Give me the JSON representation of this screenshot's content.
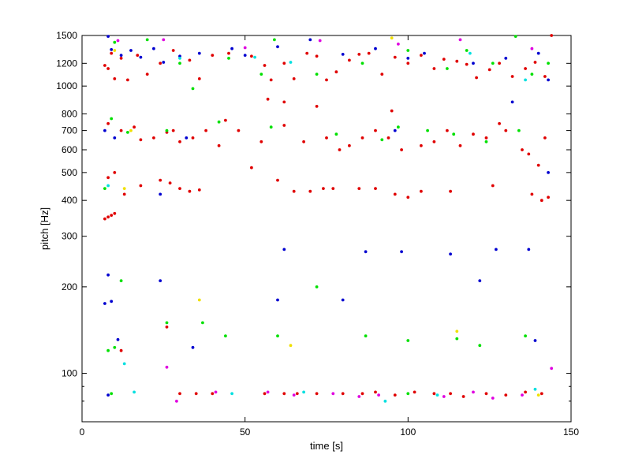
{
  "chart_data": {
    "type": "scatter",
    "title": "",
    "xlabel": "time [s]",
    "ylabel": "pitch [Hz]",
    "xlim": [
      0,
      150
    ],
    "ylim": [
      70,
      1500
    ],
    "y_scale": "log",
    "grid": false,
    "legend": "none",
    "x_ticks": [
      0,
      50,
      100,
      150
    ],
    "y_ticks": [
      100,
      200,
      300,
      400,
      500,
      600,
      700,
      800,
      1000,
      1200,
      1500
    ],
    "colors": {
      "red": "#e00000",
      "blue": "#0000d0",
      "green": "#00e000",
      "magenta": "#e000e0",
      "cyan": "#00e0e0",
      "yellow": "#f0e000"
    },
    "series": [
      {
        "color": "red",
        "points": [
          [
            7,
            1180
          ],
          [
            8,
            1150
          ],
          [
            9,
            1300
          ],
          [
            10,
            1060
          ],
          [
            12,
            1250
          ],
          [
            14,
            1050
          ],
          [
            17,
            1280
          ],
          [
            20,
            1100
          ],
          [
            24,
            1200
          ],
          [
            28,
            1330
          ],
          [
            33,
            1230
          ],
          [
            36,
            1060
          ],
          [
            40,
            1280
          ],
          [
            45,
            1300
          ],
          [
            52,
            1270
          ],
          [
            56,
            1180
          ],
          [
            58,
            1050
          ],
          [
            62,
            1200
          ],
          [
            65,
            1060
          ],
          [
            69,
            1300
          ],
          [
            72,
            1270
          ],
          [
            75,
            1050
          ],
          [
            78,
            1120
          ],
          [
            82,
            1230
          ],
          [
            85,
            1290
          ],
          [
            88,
            1300
          ],
          [
            92,
            1100
          ],
          [
            96,
            1260
          ],
          [
            100,
            1200
          ],
          [
            104,
            1280
          ],
          [
            108,
            1150
          ],
          [
            111,
            1240
          ],
          [
            115,
            1220
          ],
          [
            118,
            1190
          ],
          [
            121,
            1070
          ],
          [
            125,
            1140
          ],
          [
            128,
            1200
          ],
          [
            132,
            1080
          ],
          [
            136,
            1150
          ],
          [
            139,
            1210
          ],
          [
            142,
            1080
          ],
          [
            144,
            1500
          ],
          [
            57,
            900
          ],
          [
            62,
            880
          ],
          [
            72,
            850
          ],
          [
            95,
            820
          ],
          [
            8,
            740
          ],
          [
            12,
            700
          ],
          [
            16,
            720
          ],
          [
            18,
            650
          ],
          [
            22,
            660
          ],
          [
            26,
            690
          ],
          [
            28,
            700
          ],
          [
            30,
            640
          ],
          [
            34,
            660
          ],
          [
            38,
            700
          ],
          [
            42,
            620
          ],
          [
            44,
            760
          ],
          [
            48,
            700
          ],
          [
            55,
            640
          ],
          [
            62,
            730
          ],
          [
            68,
            640
          ],
          [
            75,
            660
          ],
          [
            79,
            600
          ],
          [
            82,
            620
          ],
          [
            86,
            660
          ],
          [
            90,
            700
          ],
          [
            94,
            660
          ],
          [
            98,
            600
          ],
          [
            104,
            620
          ],
          [
            108,
            640
          ],
          [
            112,
            700
          ],
          [
            116,
            620
          ],
          [
            120,
            680
          ],
          [
            124,
            660
          ],
          [
            128,
            740
          ],
          [
            130,
            700
          ],
          [
            135,
            600
          ],
          [
            137,
            580
          ],
          [
            140,
            530
          ],
          [
            142,
            660
          ],
          [
            8,
            480
          ],
          [
            10,
            500
          ],
          [
            13,
            420
          ],
          [
            18,
            450
          ],
          [
            24,
            470
          ],
          [
            27,
            460
          ],
          [
            30,
            440
          ],
          [
            33,
            430
          ],
          [
            36,
            435
          ],
          [
            52,
            520
          ],
          [
            60,
            470
          ],
          [
            65,
            430
          ],
          [
            70,
            430
          ],
          [
            74,
            440
          ],
          [
            77,
            440
          ],
          [
            85,
            440
          ],
          [
            90,
            440
          ],
          [
            96,
            420
          ],
          [
            100,
            410
          ],
          [
            104,
            430
          ],
          [
            113,
            430
          ],
          [
            126,
            450
          ],
          [
            138,
            420
          ],
          [
            141,
            400
          ],
          [
            143,
            410
          ],
          [
            7,
            345
          ],
          [
            8,
            350
          ],
          [
            9,
            355
          ],
          [
            10,
            360
          ],
          [
            12,
            120
          ],
          [
            26,
            145
          ],
          [
            30,
            85
          ],
          [
            35,
            85
          ],
          [
            40,
            85
          ],
          [
            56,
            85
          ],
          [
            62,
            85
          ],
          [
            66,
            85
          ],
          [
            72,
            85
          ],
          [
            80,
            85
          ],
          [
            86,
            85
          ],
          [
            90,
            86
          ],
          [
            96,
            84
          ],
          [
            102,
            86
          ],
          [
            108,
            85
          ],
          [
            113,
            85
          ],
          [
            117,
            83
          ],
          [
            124,
            85
          ],
          [
            130,
            84
          ],
          [
            136,
            86
          ],
          [
            141,
            85
          ]
        ]
      },
      {
        "color": "blue",
        "points": [
          [
            8,
            1490
          ],
          [
            9,
            1340
          ],
          [
            12,
            1280
          ],
          [
            15,
            1330
          ],
          [
            18,
            1260
          ],
          [
            22,
            1350
          ],
          [
            25,
            1210
          ],
          [
            30,
            1270
          ],
          [
            36,
            1300
          ],
          [
            46,
            1350
          ],
          [
            50,
            1280
          ],
          [
            60,
            1370
          ],
          [
            70,
            1450
          ],
          [
            80,
            1290
          ],
          [
            90,
            1350
          ],
          [
            100,
            1250
          ],
          [
            105,
            1300
          ],
          [
            120,
            1200
          ],
          [
            130,
            1250
          ],
          [
            140,
            1300
          ],
          [
            143,
            1050
          ],
          [
            7,
            700
          ],
          [
            10,
            660
          ],
          [
            24,
            420
          ],
          [
            32,
            660
          ],
          [
            96,
            700
          ],
          [
            132,
            880
          ],
          [
            143,
            500
          ],
          [
            8,
            220
          ],
          [
            7,
            175
          ],
          [
            9,
            178
          ],
          [
            24,
            210
          ],
          [
            62,
            270
          ],
          [
            87,
            265
          ],
          [
            98,
            265
          ],
          [
            113,
            260
          ],
          [
            127,
            270
          ],
          [
            137,
            270
          ],
          [
            60,
            180
          ],
          [
            80,
            180
          ],
          [
            34,
            123
          ],
          [
            11,
            131
          ],
          [
            122,
            210
          ],
          [
            8,
            84
          ],
          [
            139,
            130
          ]
        ]
      },
      {
        "color": "green",
        "points": [
          [
            10,
            1420
          ],
          [
            20,
            1450
          ],
          [
            30,
            1200
          ],
          [
            34,
            980
          ],
          [
            45,
            1250
          ],
          [
            55,
            1100
          ],
          [
            59,
            1450
          ],
          [
            72,
            1100
          ],
          [
            86,
            1200
          ],
          [
            100,
            1330
          ],
          [
            112,
            1150
          ],
          [
            118,
            1330
          ],
          [
            126,
            1200
          ],
          [
            133,
            1490
          ],
          [
            138,
            1100
          ],
          [
            143,
            1200
          ],
          [
            9,
            770
          ],
          [
            14,
            690
          ],
          [
            26,
            700
          ],
          [
            42,
            750
          ],
          [
            58,
            720
          ],
          [
            78,
            680
          ],
          [
            92,
            650
          ],
          [
            97,
            720
          ],
          [
            106,
            700
          ],
          [
            114,
            680
          ],
          [
            124,
            640
          ],
          [
            134,
            700
          ],
          [
            7,
            440
          ],
          [
            12,
            210
          ],
          [
            8,
            120
          ],
          [
            10,
            123
          ],
          [
            26,
            150
          ],
          [
            37,
            150
          ],
          [
            44,
            135
          ],
          [
            60,
            135
          ],
          [
            72,
            200
          ],
          [
            87,
            135
          ],
          [
            100,
            130
          ],
          [
            115,
            132
          ],
          [
            122,
            125
          ],
          [
            136,
            135
          ],
          [
            9,
            85
          ],
          [
            100,
            85
          ]
        ]
      },
      {
        "color": "magenta",
        "points": [
          [
            11,
            1440
          ],
          [
            25,
            1450
          ],
          [
            50,
            1360
          ],
          [
            73,
            1440
          ],
          [
            97,
            1400
          ],
          [
            116,
            1450
          ],
          [
            138,
            1350
          ],
          [
            26,
            105
          ],
          [
            29,
            80
          ],
          [
            41,
            86
          ],
          [
            65,
            84
          ],
          [
            85,
            83
          ],
          [
            91,
            84
          ],
          [
            111,
            83
          ],
          [
            120,
            86
          ],
          [
            126,
            82
          ],
          [
            135,
            84
          ],
          [
            144,
            104
          ],
          [
            57,
            86
          ],
          [
            77,
            85
          ]
        ]
      },
      {
        "color": "cyan",
        "points": [
          [
            30,
            1250
          ],
          [
            53,
            1260
          ],
          [
            64,
            1210
          ],
          [
            119,
            1300
          ],
          [
            136,
            1050
          ],
          [
            13,
            108
          ],
          [
            93,
            80
          ],
          [
            16,
            86
          ],
          [
            46,
            85
          ],
          [
            68,
            86
          ],
          [
            109,
            84
          ],
          [
            139,
            88
          ],
          [
            8,
            450
          ]
        ]
      },
      {
        "color": "yellow",
        "points": [
          [
            15,
            700
          ],
          [
            13,
            440
          ],
          [
            36,
            180
          ],
          [
            64,
            125
          ],
          [
            95,
            1470
          ],
          [
            115,
            140
          ],
          [
            140,
            84
          ],
          [
            10,
            1330
          ]
        ]
      }
    ]
  }
}
